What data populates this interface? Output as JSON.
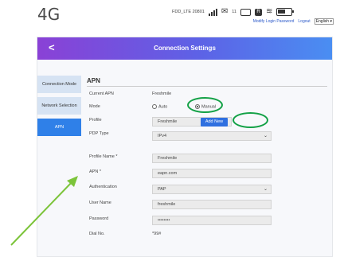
{
  "brand": "4G",
  "status": {
    "network": "FDD_LTE  20801",
    "msg_count": "11",
    "sim_label": "R"
  },
  "top_links": {
    "modify_login_password": "Modify Login Password",
    "logout": "Logout",
    "language": "English ▾"
  },
  "header": {
    "back": "<",
    "title": "Connection Settings"
  },
  "nav": [
    "Connection Mode",
    "Network Selection",
    "APN"
  ],
  "section_title": "APN",
  "form": {
    "current_apn": {
      "label": "Current APN",
      "value": "Freshmile"
    },
    "mode": {
      "label": "Mode",
      "auto": "Auto",
      "manual": "Manual",
      "selected": "Manual"
    },
    "profile": {
      "label": "Profile",
      "value": "Freshmile",
      "add_new": "Add New"
    },
    "pdp_type": {
      "label": "PDP Type",
      "value": "IPv4"
    },
    "profile_name": {
      "label": "Profile Name *",
      "value": "Freshmile"
    },
    "apn": {
      "label": "APN *",
      "value": "eapn.com"
    },
    "authentication": {
      "label": "Authentication",
      "value": "PAP"
    },
    "user_name": {
      "label": "User Name",
      "value": "freshmile"
    },
    "password": {
      "label": "Password",
      "value": "••••••••"
    },
    "dial_no": {
      "label": "Dial No.",
      "value": "*99#"
    }
  },
  "colors": {
    "accent_blue": "#2f80e8",
    "highlight_green": "#13a146",
    "header_start": "#8a41d6",
    "header_end": "#4a8ef2"
  },
  "icons": [
    "signal-icon",
    "message-icon",
    "sim-icon",
    "wifi-icon",
    "battery-icon",
    "back-chevron-icon",
    "chevron-down-icon"
  ]
}
